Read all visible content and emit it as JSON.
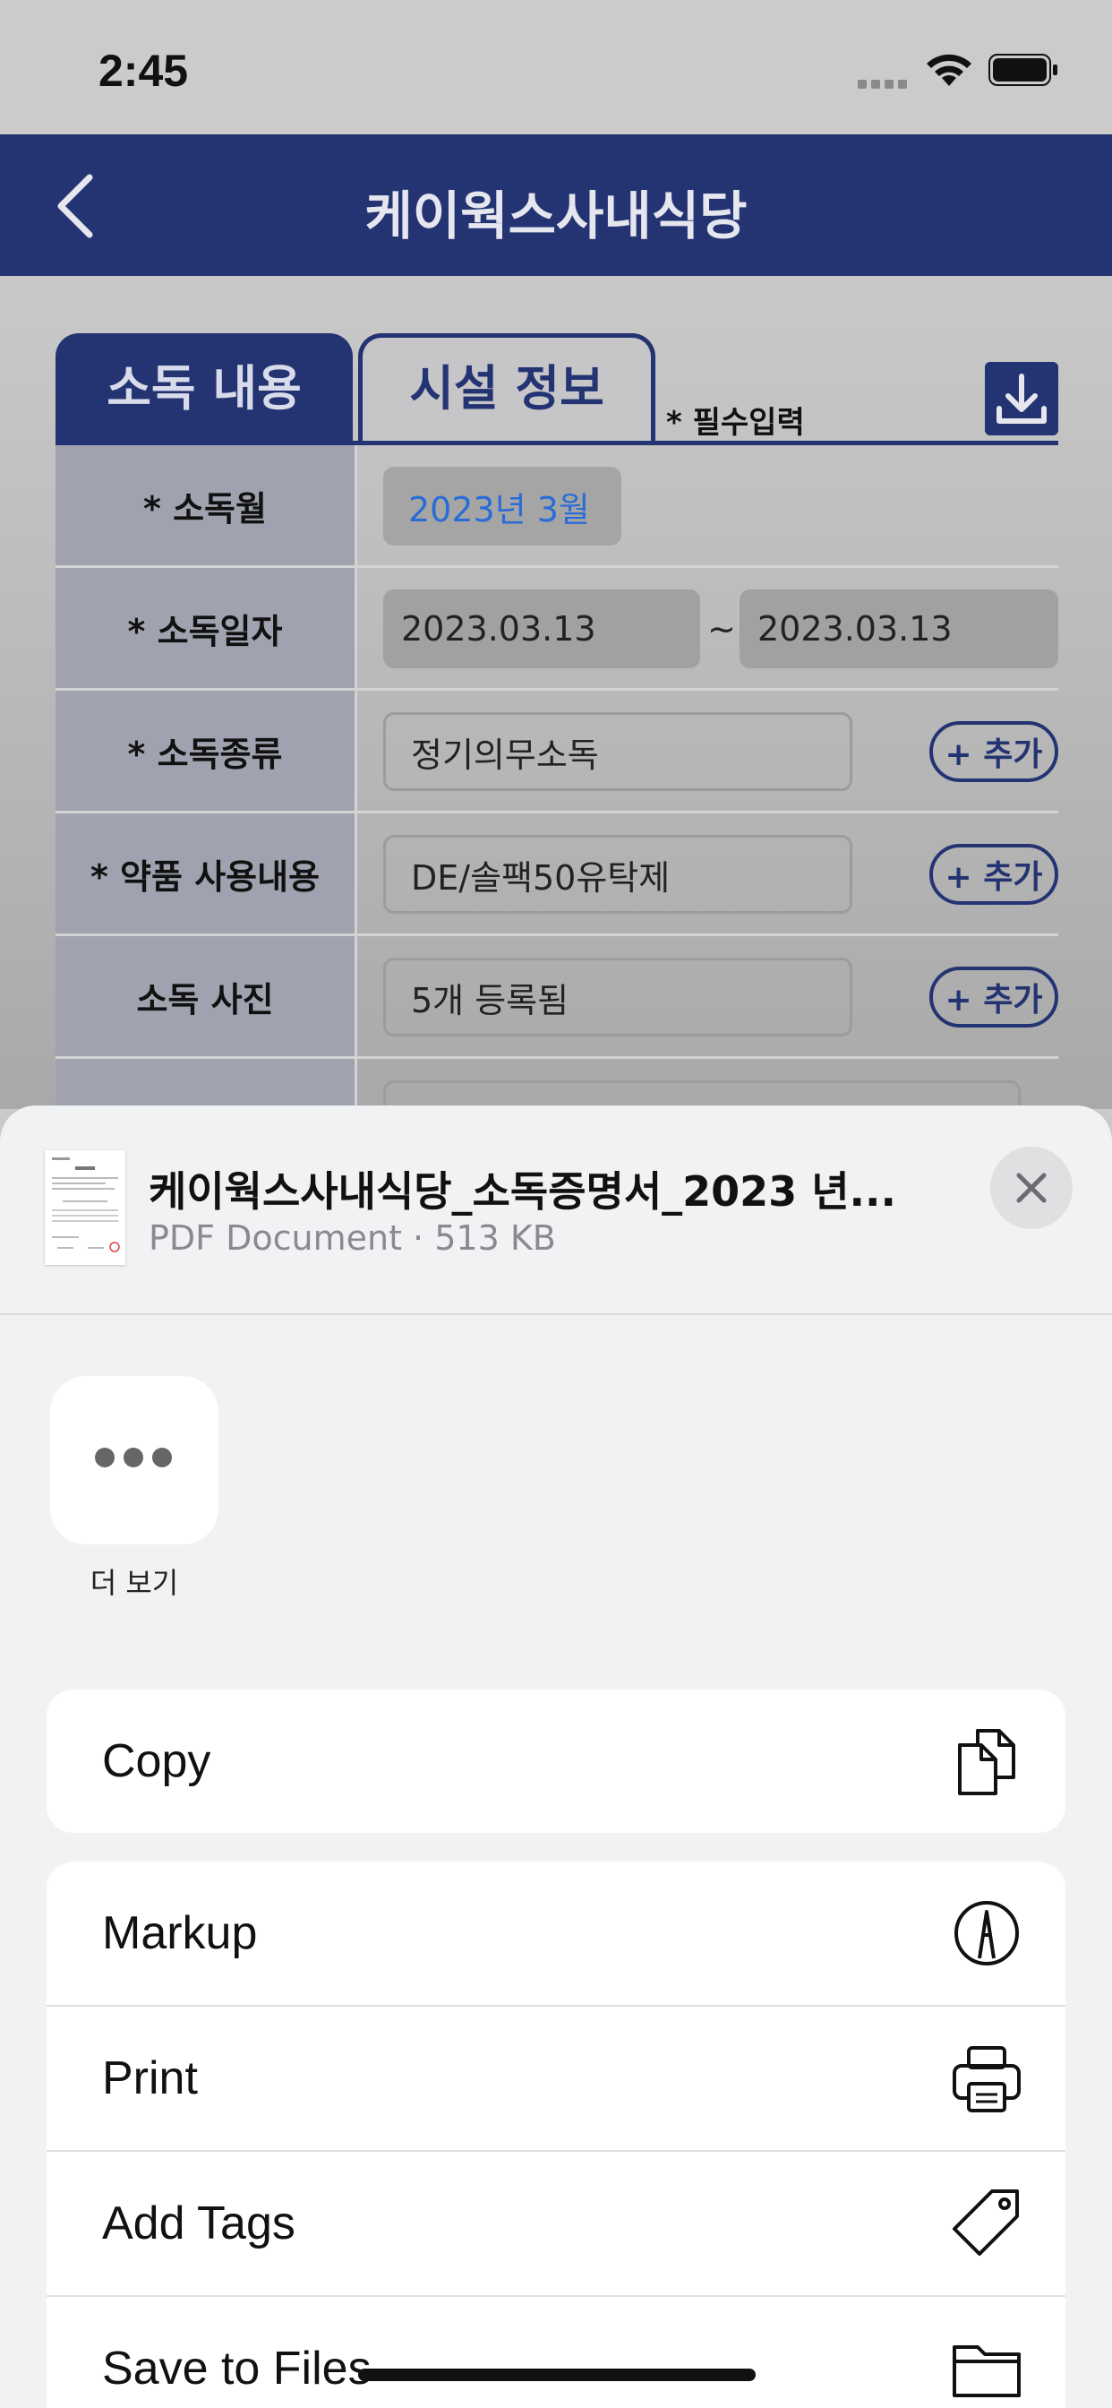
{
  "status": {
    "time": "2:45"
  },
  "nav": {
    "title": "케이웍스사내식당"
  },
  "tabs": [
    {
      "label": "소독 내용"
    },
    {
      "label": "시설 정보"
    }
  ],
  "required_note": "* 필수입력",
  "form": {
    "month_label": "* 소독월",
    "month_value": "2023년 3월",
    "date_label": "* 소독일자",
    "date_start": "2023.03.13",
    "date_sep": "~",
    "date_end": "2023.03.13",
    "type_label": "* 소독종류",
    "type_value": "정기의무소독",
    "chem_label": "* 약품 사용내용",
    "chem_value": "DE/솔팩50유탁제",
    "photo_label": "소독 사진",
    "photo_value": "5개 등록됨",
    "add_label": "+ 추가"
  },
  "share": {
    "file_name": "케이웍스사내식당_소독증명서_2023 년...",
    "file_meta": "PDF Document · 513 KB",
    "more_label": "더 보기",
    "actions": [
      {
        "label": "Copy",
        "icon": "copy-icon"
      },
      {
        "label": "Markup",
        "icon": "markup-icon"
      },
      {
        "label": "Print",
        "icon": "printer-icon"
      },
      {
        "label": "Add Tags",
        "icon": "tag-icon"
      },
      {
        "label": "Save to Files",
        "icon": "folder-icon"
      }
    ]
  },
  "colors": {
    "navy": "#243473",
    "link_blue": "#2a6cd6"
  }
}
